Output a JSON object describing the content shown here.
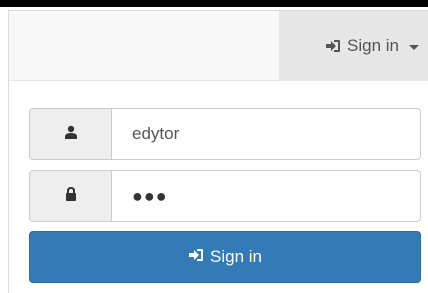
{
  "navbar": {
    "signin_label": "Sign in",
    "signin_icon": "log-in-icon",
    "caret_icon": "caret-down-icon"
  },
  "form": {
    "username_icon": "user-icon",
    "username_value": "edytor",
    "password_icon": "lock-icon",
    "password_masked": "●●●",
    "submit_label": "Sign in",
    "submit_icon": "log-in-icon"
  },
  "colors": {
    "primary": "#337ab7",
    "navbar_bg": "#f8f8f8",
    "toggle_bg": "#e7e7e7",
    "addon_bg": "#eeeeee",
    "text": "#555555"
  }
}
